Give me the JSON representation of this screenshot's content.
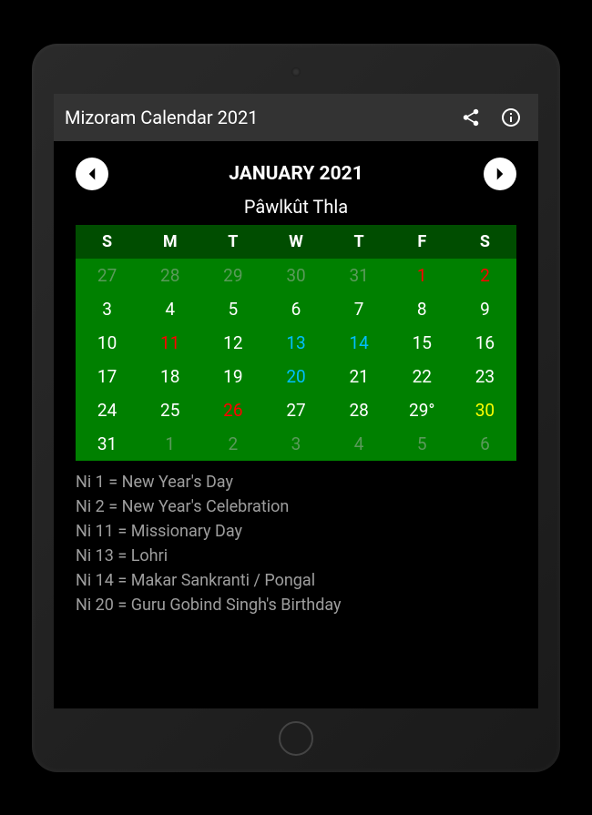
{
  "appBar": {
    "title": "Mizoram Calendar 2021"
  },
  "header": {
    "monthLabel": "JANUARY 2021",
    "subtitle": "Pâwlkût Thla"
  },
  "dayHeaders": [
    "S",
    "M",
    "T",
    "W",
    "T",
    "F",
    "S"
  ],
  "weeks": [
    [
      {
        "d": "27",
        "cls": "c-dim"
      },
      {
        "d": "28",
        "cls": "c-dim"
      },
      {
        "d": "29",
        "cls": "c-dim"
      },
      {
        "d": "30",
        "cls": "c-dim"
      },
      {
        "d": "31",
        "cls": "c-dim"
      },
      {
        "d": "1",
        "cls": "c-red"
      },
      {
        "d": "2",
        "cls": "c-red"
      }
    ],
    [
      {
        "d": "3",
        "cls": "c-white"
      },
      {
        "d": "4",
        "cls": "c-white"
      },
      {
        "d": "5",
        "cls": "c-white"
      },
      {
        "d": "6",
        "cls": "c-white"
      },
      {
        "d": "7",
        "cls": "c-white"
      },
      {
        "d": "8",
        "cls": "c-white"
      },
      {
        "d": "9",
        "cls": "c-white"
      }
    ],
    [
      {
        "d": "10",
        "cls": "c-white"
      },
      {
        "d": "11",
        "cls": "c-red"
      },
      {
        "d": "12",
        "cls": "c-white"
      },
      {
        "d": "13",
        "cls": "c-blue"
      },
      {
        "d": "14",
        "cls": "c-blue"
      },
      {
        "d": "15",
        "cls": "c-white"
      },
      {
        "d": "16",
        "cls": "c-white"
      }
    ],
    [
      {
        "d": "17",
        "cls": "c-white"
      },
      {
        "d": "18",
        "cls": "c-white"
      },
      {
        "d": "19",
        "cls": "c-white"
      },
      {
        "d": "20",
        "cls": "c-blue"
      },
      {
        "d": "21",
        "cls": "c-white"
      },
      {
        "d": "22",
        "cls": "c-white"
      },
      {
        "d": "23",
        "cls": "c-white"
      }
    ],
    [
      {
        "d": "24",
        "cls": "c-white"
      },
      {
        "d": "25",
        "cls": "c-white"
      },
      {
        "d": "26",
        "cls": "c-red"
      },
      {
        "d": "27",
        "cls": "c-white"
      },
      {
        "d": "28",
        "cls": "c-white"
      },
      {
        "d": "29°",
        "cls": "c-white"
      },
      {
        "d": "30",
        "cls": "c-yellow"
      }
    ],
    [
      {
        "d": "31",
        "cls": "c-white"
      },
      {
        "d": "1",
        "cls": "c-dim"
      },
      {
        "d": "2",
        "cls": "c-dim"
      },
      {
        "d": "3",
        "cls": "c-dim"
      },
      {
        "d": "4",
        "cls": "c-dim"
      },
      {
        "d": "5",
        "cls": "c-dim"
      },
      {
        "d": "6",
        "cls": "c-dim"
      }
    ]
  ],
  "events": [
    "Ni 1 = New Year's Day",
    "Ni 2 = New Year's Celebration",
    "Ni 11 = Missionary Day",
    "Ni 13 = Lohri",
    "Ni 14 = Makar Sankranti / Pongal",
    "Ni 20 = Guru Gobind Singh's Birthday"
  ]
}
